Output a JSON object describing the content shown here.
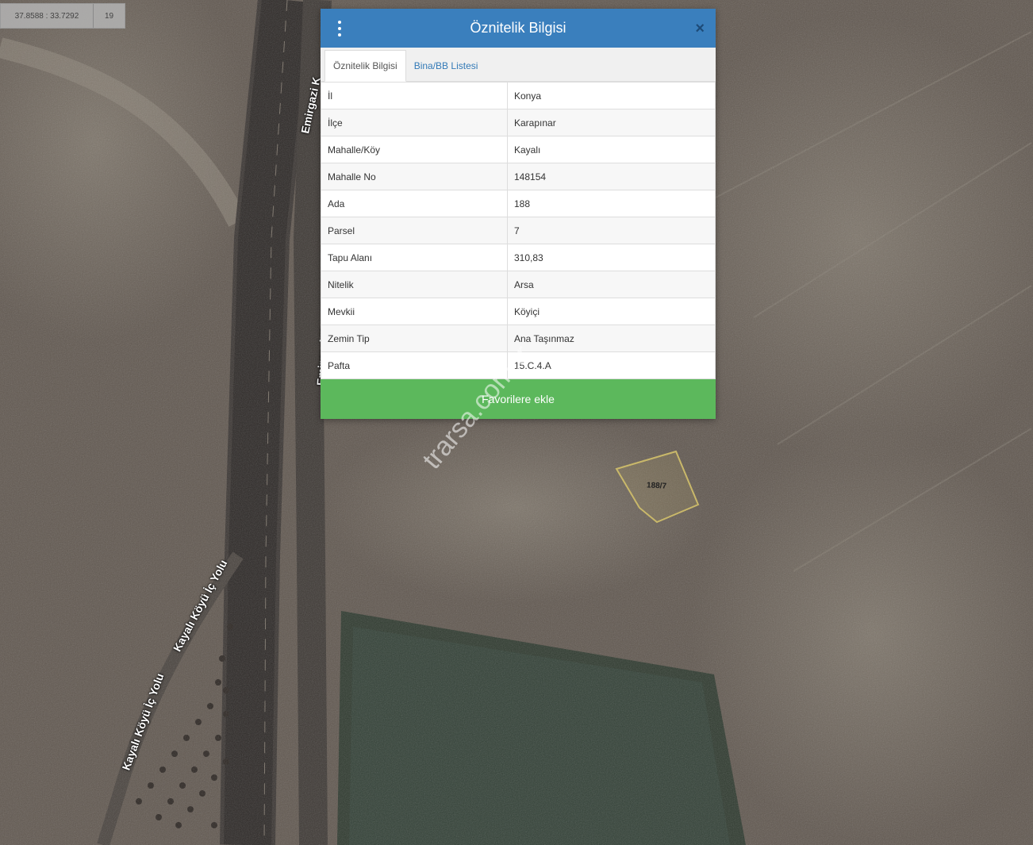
{
  "map": {
    "coordinates": "37.8588 : 33.7292",
    "zoom": "19",
    "road_labels": [
      "Emirgazi K",
      "Emirgazi K",
      "Kayalı Köyü İç Yolu",
      "Kayalı Köyü İç Yolu"
    ],
    "parcel_label": "188/7",
    "watermark": "trarsa.com.tr",
    "colors": {
      "header": "#3a7fbd",
      "favorite_button": "#5cb85c",
      "parcel_outline": "#c9b86a"
    }
  },
  "dialog": {
    "title": "Öznitelik Bilgisi",
    "menu_icon": "vertical-dots-icon",
    "close_icon": "close-icon",
    "tabs": [
      {
        "label": "Öznitelik Bilgisi",
        "active": true
      },
      {
        "label": "Bina/BB Listesi",
        "active": false
      }
    ],
    "rows": [
      {
        "key": "İl",
        "value": "Konya"
      },
      {
        "key": "İlçe",
        "value": "Karapınar"
      },
      {
        "key": "Mahalle/Köy",
        "value": "Kayalı"
      },
      {
        "key": "Mahalle No",
        "value": "148154"
      },
      {
        "key": "Ada",
        "value": "188"
      },
      {
        "key": "Parsel",
        "value": "7"
      },
      {
        "key": "Tapu Alanı",
        "value": "310,83"
      },
      {
        "key": "Nitelik",
        "value": "Arsa"
      },
      {
        "key": "Mevkii",
        "value": "Köyiçi"
      },
      {
        "key": "Zemin Tip",
        "value": "Ana Taşınmaz"
      },
      {
        "key": "Pafta",
        "value": "15.C.4.A"
      }
    ],
    "favorite_button": "Favorilere ekle"
  }
}
